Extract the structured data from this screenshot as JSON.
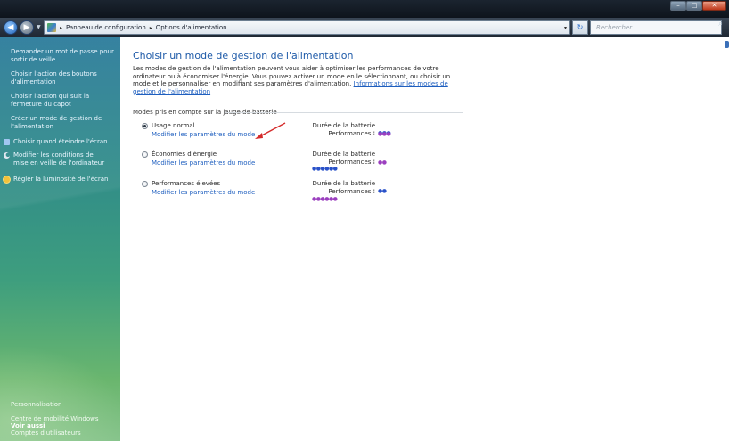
{
  "window": {
    "minimize_icon": "minimize-icon",
    "maximize_icon": "maximize-icon",
    "close_icon": "close-icon",
    "minimize": "–",
    "maximize": "□",
    "close": "✕"
  },
  "address": {
    "back": "◀",
    "forward": "▶",
    "history": "▼",
    "root": "Panneau de configuration",
    "current": "Options d'alimentation",
    "separator": "▸",
    "dropdown": "▾",
    "refresh": "↻",
    "search_placeholder": "Rechercher",
    "search_icon": "⌕"
  },
  "sidebar": {
    "tasks": [
      "Demander un mot de passe pour sortir de veille",
      "Choisir l'action des boutons d'alimentation",
      "Choisir l'action qui suit la fermeture du capot",
      "Créer un mode de gestion de l'alimentation"
    ],
    "icon_tasks": [
      {
        "label": "Choisir quand éteindre l'écran",
        "icon": "display-icon",
        "color": "#9fc6f0"
      },
      {
        "label": "Modifier les conditions de mise en veille de l'ordinateur",
        "icon": "moon-icon",
        "color": "#dfe8f0"
      },
      {
        "label": "Régler la luminosité de l'écran",
        "icon": "sun-icon",
        "color": "#f2c23a"
      }
    ],
    "see_also_title": "Voir aussi",
    "see_also": [
      "Personnalisation",
      "Centre de mobilité Windows",
      "Comptes d'utilisateurs"
    ]
  },
  "main": {
    "title": "Choisir un mode de gestion de l'alimentation",
    "intro": "Les modes de gestion de l'alimentation peuvent vous aider à optimiser les performances de votre ordinateur ou à économiser l'énergie. Vous pouvez activer un mode en le sélectionnant, ou choisir un mode et le personnaliser en modifiant ses paramètres d'alimentation.",
    "intro_link": "Informations sur les modes de gestion de l'alimentation",
    "group_label": "Modes pris en compte sur la jauge de batterie",
    "battery_label": "Durée de la batterie :",
    "performance_label": "Performances :",
    "plans": [
      {
        "name": "Usage normal",
        "link": "Modifier les paramètres du mode",
        "selected": true,
        "battery": "●●●",
        "performance": "●●●"
      },
      {
        "name": "Économies d'énergie",
        "link": "Modifier les paramètres du mode",
        "selected": false,
        "battery": "●●●●●●",
        "performance": "●●"
      },
      {
        "name": "Performances élevées",
        "link": "Modifier les paramètres du mode",
        "selected": false,
        "battery": "●●",
        "performance": "●●●●●●"
      }
    ]
  },
  "colors": {
    "accent": "#1e5aa8",
    "link": "#1f5fbf",
    "battery_dots": "#2a52c9",
    "performance_dots": "#9b3fbf",
    "annotation_arrow": "#d42a2a"
  }
}
